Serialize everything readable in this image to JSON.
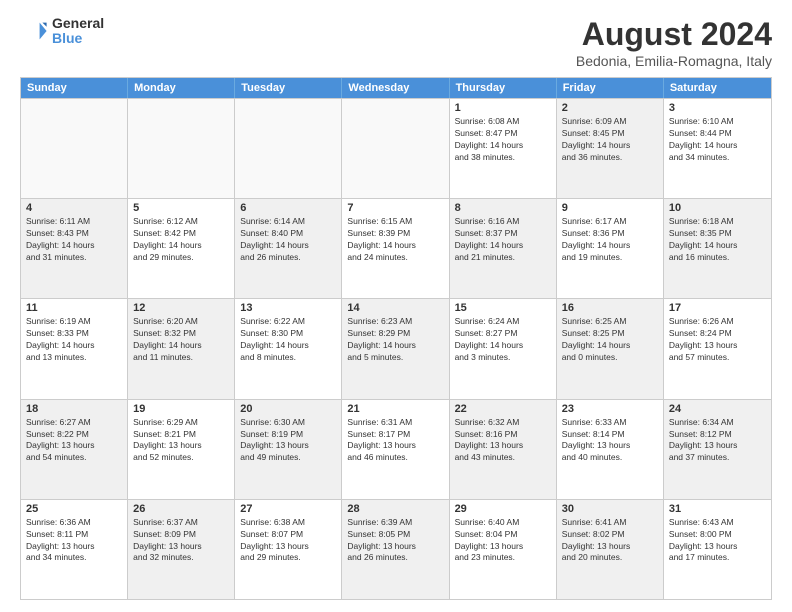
{
  "logo": {
    "line1": "General",
    "line2": "Blue"
  },
  "title": "August 2024",
  "subtitle": "Bedonia, Emilia-Romagna, Italy",
  "header_days": [
    "Sunday",
    "Monday",
    "Tuesday",
    "Wednesday",
    "Thursday",
    "Friday",
    "Saturday"
  ],
  "rows": [
    [
      {
        "day": "",
        "text": "",
        "empty": true
      },
      {
        "day": "",
        "text": "",
        "empty": true
      },
      {
        "day": "",
        "text": "",
        "empty": true
      },
      {
        "day": "",
        "text": "",
        "empty": true
      },
      {
        "day": "1",
        "text": "Sunrise: 6:08 AM\nSunset: 8:47 PM\nDaylight: 14 hours\nand 38 minutes.",
        "empty": false
      },
      {
        "day": "2",
        "text": "Sunrise: 6:09 AM\nSunset: 8:45 PM\nDaylight: 14 hours\nand 36 minutes.",
        "empty": false,
        "shaded": true
      },
      {
        "day": "3",
        "text": "Sunrise: 6:10 AM\nSunset: 8:44 PM\nDaylight: 14 hours\nand 34 minutes.",
        "empty": false
      }
    ],
    [
      {
        "day": "4",
        "text": "Sunrise: 6:11 AM\nSunset: 8:43 PM\nDaylight: 14 hours\nand 31 minutes.",
        "empty": false,
        "shaded": true
      },
      {
        "day": "5",
        "text": "Sunrise: 6:12 AM\nSunset: 8:42 PM\nDaylight: 14 hours\nand 29 minutes.",
        "empty": false
      },
      {
        "day": "6",
        "text": "Sunrise: 6:14 AM\nSunset: 8:40 PM\nDaylight: 14 hours\nand 26 minutes.",
        "empty": false,
        "shaded": true
      },
      {
        "day": "7",
        "text": "Sunrise: 6:15 AM\nSunset: 8:39 PM\nDaylight: 14 hours\nand 24 minutes.",
        "empty": false
      },
      {
        "day": "8",
        "text": "Sunrise: 6:16 AM\nSunset: 8:37 PM\nDaylight: 14 hours\nand 21 minutes.",
        "empty": false,
        "shaded": true
      },
      {
        "day": "9",
        "text": "Sunrise: 6:17 AM\nSunset: 8:36 PM\nDaylight: 14 hours\nand 19 minutes.",
        "empty": false
      },
      {
        "day": "10",
        "text": "Sunrise: 6:18 AM\nSunset: 8:35 PM\nDaylight: 14 hours\nand 16 minutes.",
        "empty": false,
        "shaded": true
      }
    ],
    [
      {
        "day": "11",
        "text": "Sunrise: 6:19 AM\nSunset: 8:33 PM\nDaylight: 14 hours\nand 13 minutes.",
        "empty": false
      },
      {
        "day": "12",
        "text": "Sunrise: 6:20 AM\nSunset: 8:32 PM\nDaylight: 14 hours\nand 11 minutes.",
        "empty": false,
        "shaded": true
      },
      {
        "day": "13",
        "text": "Sunrise: 6:22 AM\nSunset: 8:30 PM\nDaylight: 14 hours\nand 8 minutes.",
        "empty": false
      },
      {
        "day": "14",
        "text": "Sunrise: 6:23 AM\nSunset: 8:29 PM\nDaylight: 14 hours\nand 5 minutes.",
        "empty": false,
        "shaded": true
      },
      {
        "day": "15",
        "text": "Sunrise: 6:24 AM\nSunset: 8:27 PM\nDaylight: 14 hours\nand 3 minutes.",
        "empty": false
      },
      {
        "day": "16",
        "text": "Sunrise: 6:25 AM\nSunset: 8:25 PM\nDaylight: 14 hours\nand 0 minutes.",
        "empty": false,
        "shaded": true
      },
      {
        "day": "17",
        "text": "Sunrise: 6:26 AM\nSunset: 8:24 PM\nDaylight: 13 hours\nand 57 minutes.",
        "empty": false
      }
    ],
    [
      {
        "day": "18",
        "text": "Sunrise: 6:27 AM\nSunset: 8:22 PM\nDaylight: 13 hours\nand 54 minutes.",
        "empty": false,
        "shaded": true
      },
      {
        "day": "19",
        "text": "Sunrise: 6:29 AM\nSunset: 8:21 PM\nDaylight: 13 hours\nand 52 minutes.",
        "empty": false
      },
      {
        "day": "20",
        "text": "Sunrise: 6:30 AM\nSunset: 8:19 PM\nDaylight: 13 hours\nand 49 minutes.",
        "empty": false,
        "shaded": true
      },
      {
        "day": "21",
        "text": "Sunrise: 6:31 AM\nSunset: 8:17 PM\nDaylight: 13 hours\nand 46 minutes.",
        "empty": false
      },
      {
        "day": "22",
        "text": "Sunrise: 6:32 AM\nSunset: 8:16 PM\nDaylight: 13 hours\nand 43 minutes.",
        "empty": false,
        "shaded": true
      },
      {
        "day": "23",
        "text": "Sunrise: 6:33 AM\nSunset: 8:14 PM\nDaylight: 13 hours\nand 40 minutes.",
        "empty": false
      },
      {
        "day": "24",
        "text": "Sunrise: 6:34 AM\nSunset: 8:12 PM\nDaylight: 13 hours\nand 37 minutes.",
        "empty": false,
        "shaded": true
      }
    ],
    [
      {
        "day": "25",
        "text": "Sunrise: 6:36 AM\nSunset: 8:11 PM\nDaylight: 13 hours\nand 34 minutes.",
        "empty": false
      },
      {
        "day": "26",
        "text": "Sunrise: 6:37 AM\nSunset: 8:09 PM\nDaylight: 13 hours\nand 32 minutes.",
        "empty": false,
        "shaded": true
      },
      {
        "day": "27",
        "text": "Sunrise: 6:38 AM\nSunset: 8:07 PM\nDaylight: 13 hours\nand 29 minutes.",
        "empty": false
      },
      {
        "day": "28",
        "text": "Sunrise: 6:39 AM\nSunset: 8:05 PM\nDaylight: 13 hours\nand 26 minutes.",
        "empty": false,
        "shaded": true
      },
      {
        "day": "29",
        "text": "Sunrise: 6:40 AM\nSunset: 8:04 PM\nDaylight: 13 hours\nand 23 minutes.",
        "empty": false
      },
      {
        "day": "30",
        "text": "Sunrise: 6:41 AM\nSunset: 8:02 PM\nDaylight: 13 hours\nand 20 minutes.",
        "empty": false,
        "shaded": true
      },
      {
        "day": "31",
        "text": "Sunrise: 6:43 AM\nSunset: 8:00 PM\nDaylight: 13 hours\nand 17 minutes.",
        "empty": false
      }
    ]
  ]
}
